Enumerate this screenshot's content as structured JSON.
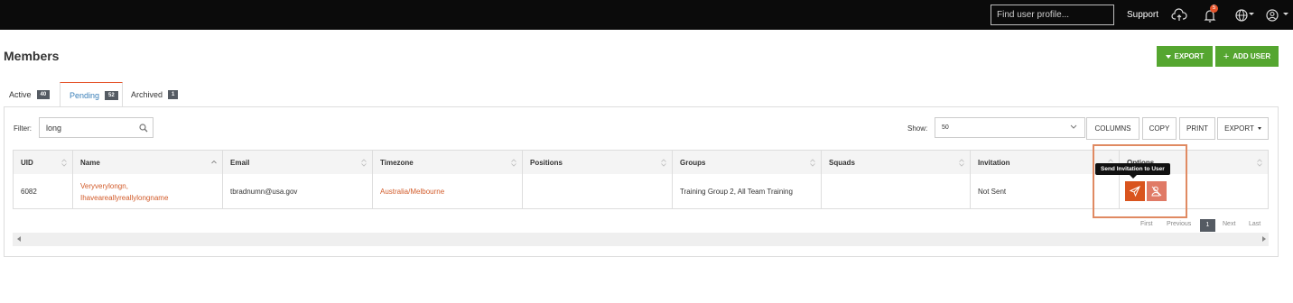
{
  "topbar": {
    "search_placeholder": "Find user profile...",
    "support_label": "Support",
    "notification_count": "5",
    "icons": [
      "cloud-upload-icon",
      "bell-icon",
      "globe-icon",
      "user-circle-icon"
    ]
  },
  "page": {
    "title": "Members",
    "export_label": "EXPORT",
    "add_user_label": "ADD USER"
  },
  "tabs": [
    {
      "label": "Active",
      "count": "40"
    },
    {
      "label": "Pending",
      "count": "52"
    },
    {
      "label": "Archived",
      "count": "1"
    }
  ],
  "filter": {
    "label": "Filter:",
    "value": "long"
  },
  "show": {
    "label": "Show:",
    "value": "50"
  },
  "toolbar": {
    "columns": "COLUMNS",
    "copy": "COPY",
    "print": "PRINT",
    "export": "EXPORT"
  },
  "table": {
    "headers": [
      "UID",
      "Name",
      "Email",
      "Timezone",
      "Positions",
      "Groups",
      "Squads",
      "Invitation",
      "Options"
    ],
    "rows": [
      {
        "uid": "6082",
        "name_line1": "Veryverylongn,",
        "name_line2": "Ihaveareallyreallylongname",
        "email": "tbradnumn@usa.gov",
        "timezone": "Australia/Melbourne",
        "positions": "",
        "groups": "Training Group 2, All Team Training",
        "squads": "",
        "invitation": "Not Sent"
      }
    ]
  },
  "tooltip": "Send Invitation to User",
  "pagination": {
    "first": "First",
    "previous": "Previous",
    "current": "1",
    "next": "Next",
    "last": "Last"
  },
  "colors": {
    "accent": "#e5532a",
    "green": "#55a630",
    "link": "#d25b2a"
  }
}
